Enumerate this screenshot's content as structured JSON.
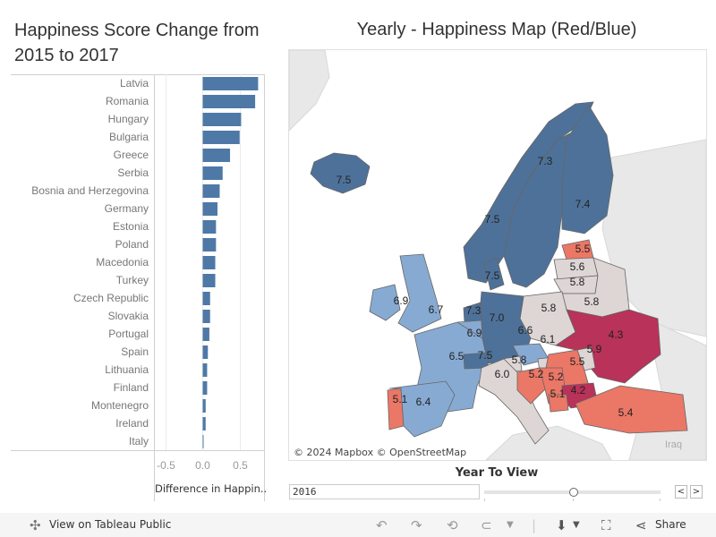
{
  "bar_panel": {
    "title": "Happiness Score Change from 2015 to 2017"
  },
  "map_panel": {
    "title": "Yearly - Happiness Map (Red/Blue)",
    "attribution": "© 2024 Mapbox  © OpenStreetMap",
    "basemap_label": "Iraq"
  },
  "chart_data": [
    {
      "type": "bar",
      "orientation": "horizontal",
      "title": "Happiness Score Change from 2015 to 2017",
      "xlabel": "Difference in Happin..",
      "ylabel": "",
      "xlim": [
        -0.66,
        0.83
      ],
      "xticks": [
        -0.5,
        0.0,
        0.5
      ],
      "xtick_labels": [
        "-0.5",
        "0.0",
        "0.5"
      ],
      "grid": true,
      "color": "#4e79a7",
      "categories": [
        "Latvia",
        "Romania",
        "Hungary",
        "Bulgaria",
        "Greece",
        "Serbia",
        "Bosnia and Herzegovina",
        "Germany",
        "Estonia",
        "Poland",
        "Macedonia",
        "Turkey",
        "Czech Republic",
        "Slovakia",
        "Portugal",
        "Spain",
        "Lithuania",
        "Finland",
        "Montenegro",
        "Ireland",
        "Italy"
      ],
      "values": [
        0.75,
        0.71,
        0.52,
        0.5,
        0.37,
        0.27,
        0.23,
        0.2,
        0.18,
        0.18,
        0.17,
        0.17,
        0.1,
        0.1,
        0.09,
        0.07,
        0.06,
        0.06,
        0.04,
        0.04,
        0.01
      ]
    },
    {
      "type": "heatmap",
      "subtype": "choropleth",
      "title": "Yearly - Happiness Map (Red/Blue)",
      "year": "2016",
      "color_scale": {
        "low": "#b8325a",
        "mid_low": "#eb7766",
        "mid": "#ddd6d5",
        "mid_high": "#87aad3",
        "high": "#4e7199"
      },
      "regions": [
        {
          "name": "Iceland",
          "value": 7.5
        },
        {
          "name": "Norway",
          "value": 7.5
        },
        {
          "name": "Sweden",
          "value": 7.3
        },
        {
          "name": "Finland",
          "value": 7.4
        },
        {
          "name": "Estonia",
          "value": 5.5
        },
        {
          "name": "Latvia",
          "value": 5.6
        },
        {
          "name": "Lithuania",
          "value": 5.8
        },
        {
          "name": "Belarus",
          "value": 5.8
        },
        {
          "name": "Poland",
          "value": 5.8
        },
        {
          "name": "Denmark",
          "value": 7.5
        },
        {
          "name": "Ireland",
          "value": 6.9
        },
        {
          "name": "United Kingdom",
          "value": 6.7
        },
        {
          "name": "Netherlands",
          "value": 7.3
        },
        {
          "name": "Belgium",
          "value": 6.9
        },
        {
          "name": "Germany",
          "value": 7.0
        },
        {
          "name": "Czech Republic",
          "value": 6.6
        },
        {
          "name": "Slovakia",
          "value": 6.1
        },
        {
          "name": "Ukraine",
          "value": 4.3
        },
        {
          "name": "Moldova",
          "value": 5.9
        },
        {
          "name": "Romania",
          "value": 5.5
        },
        {
          "name": "France",
          "value": 6.5
        },
        {
          "name": "Switzerland",
          "value": 7.5
        },
        {
          "name": "Slovenia",
          "value": 5.8
        },
        {
          "name": "Italy",
          "value": 6.0
        },
        {
          "name": "Croatia",
          "value": 5.2
        },
        {
          "name": "Serbia",
          "value": 5.2
        },
        {
          "name": "Bulgaria",
          "value": 4.2
        },
        {
          "name": "Macedonia",
          "value": 5.1
        },
        {
          "name": "Portugal",
          "value": 5.1
        },
        {
          "name": "Spain",
          "value": 6.4
        },
        {
          "name": "Turkey",
          "value": 5.4
        }
      ]
    }
  ],
  "filter": {
    "title": "Year To View",
    "value": "2016",
    "prev_label": "<",
    "next_label": ">"
  },
  "footer": {
    "view_label": "View on Tableau Public",
    "share_label": "Share"
  }
}
